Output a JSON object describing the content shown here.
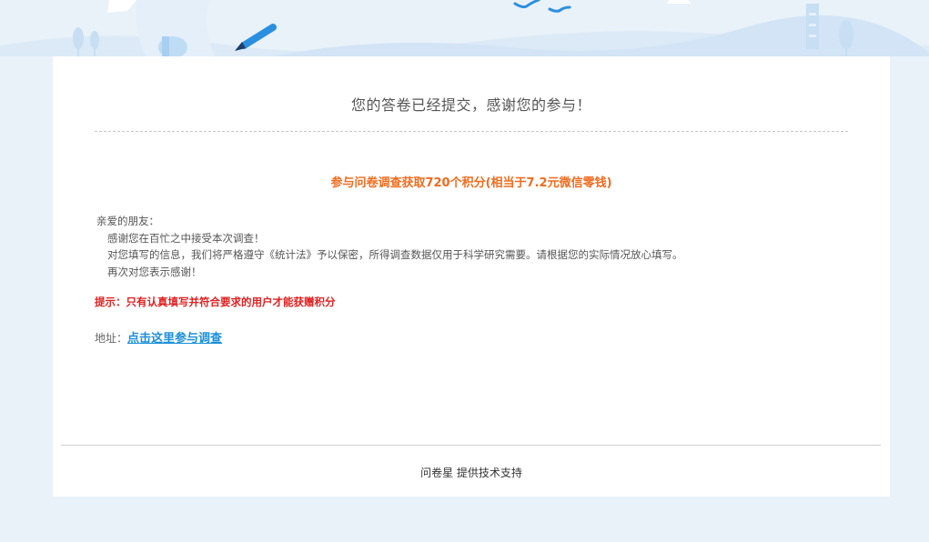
{
  "page": {
    "title": "您的答卷已经提交，感谢您的参与！",
    "reward": "参与问卷调查获取720个积分(相当于7.2元微信零钱)",
    "letter": {
      "salutation": "亲爱的朋友：",
      "lines": [
        "感谢您在百忙之中接受本次调查！",
        "对您填写的信息，我们将严格遵守《统计法》予以保密，所得调查数据仅用于科学研究需要。请根据您的实际情况放心填写。",
        "再次对您表示感谢！"
      ]
    },
    "tip": "提示：只有认真填写并符合要求的用户才能获赠积分",
    "address": {
      "label": "地址：",
      "link_text": "点击这里参与调查"
    },
    "footer": {
      "brand": "问卷星",
      "suffix": " 提供技术支持"
    }
  },
  "colors": {
    "background": "#e9f1f9",
    "card": "#ffffff",
    "reward": "#f26b1d",
    "tip": "#e02020",
    "link": "#1a8fd8"
  },
  "icons": {
    "pen": "pen-icon",
    "birds": "birds-icon",
    "document": "document-icon",
    "lighthouse": "lighthouse-icon"
  }
}
